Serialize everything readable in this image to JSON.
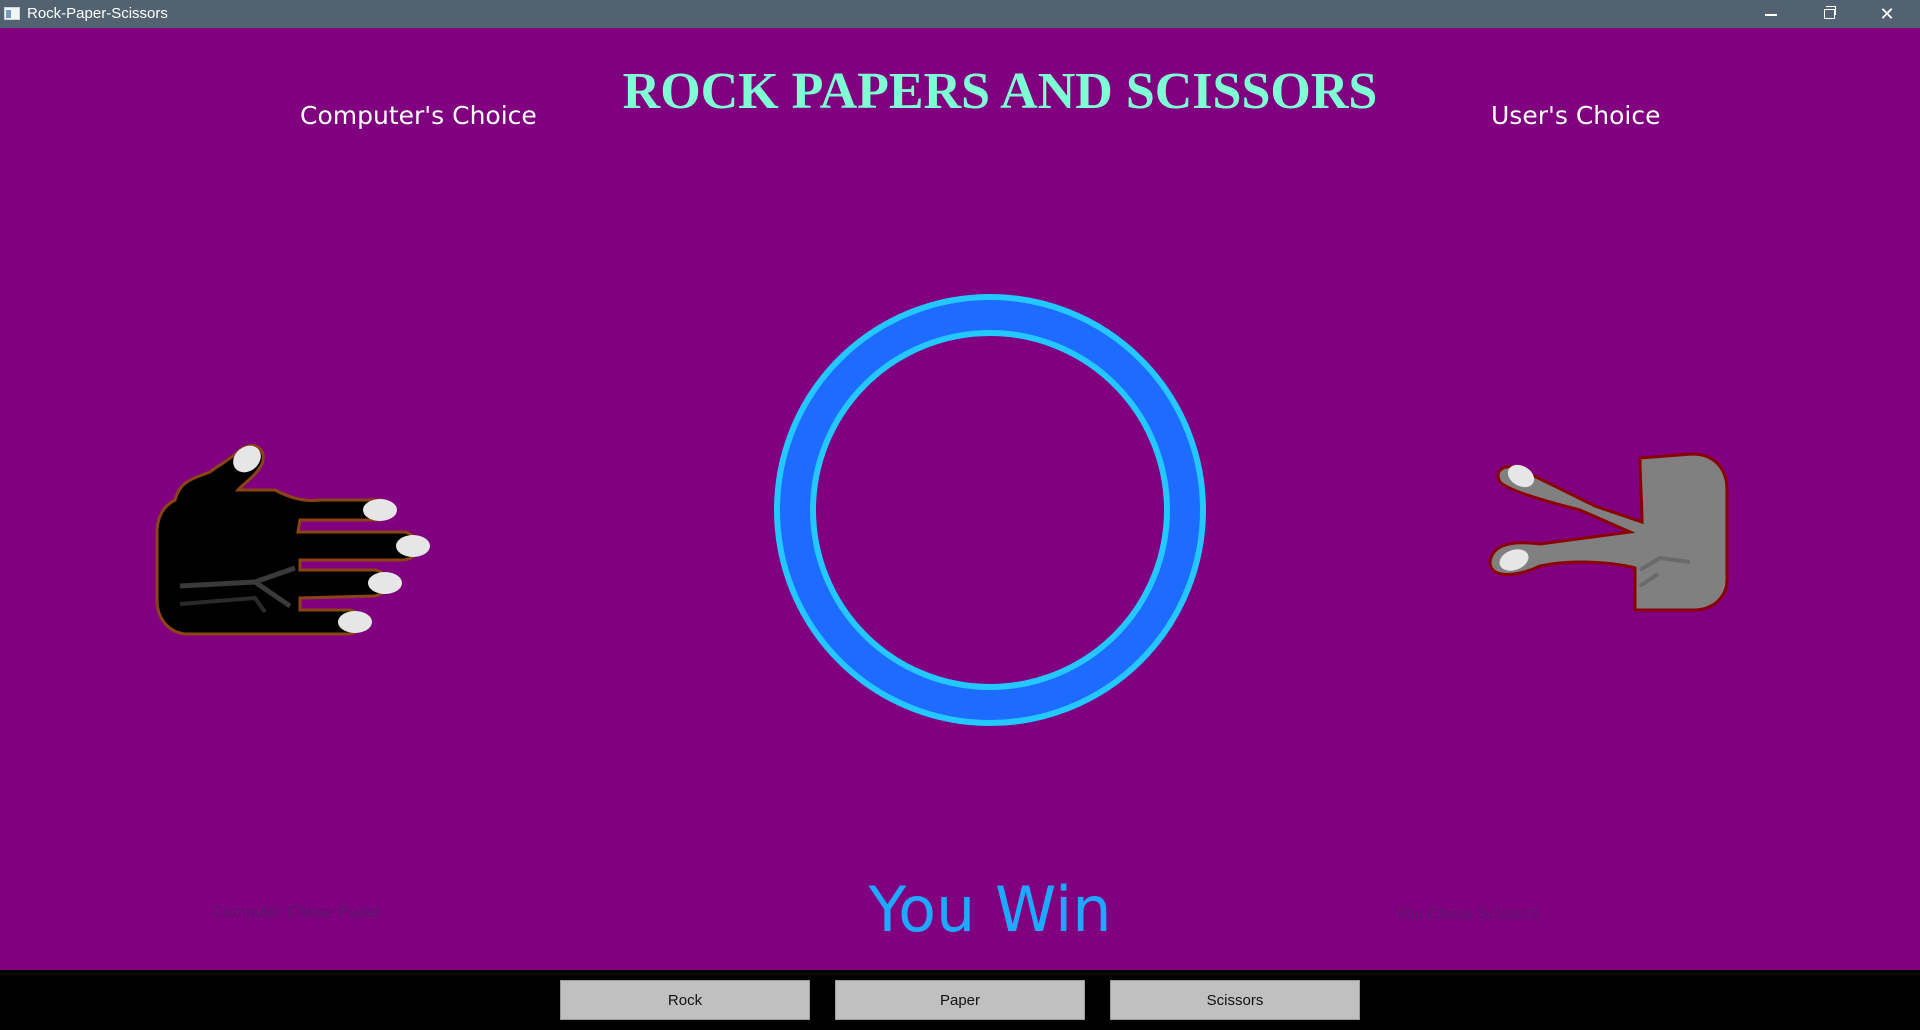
{
  "window": {
    "title": "Rock-Paper-Scissors",
    "minimize_icon": "minimize-icon",
    "maximize_icon": "restore-icon",
    "close_icon": "close-icon"
  },
  "game": {
    "title": "ROCK PAPERS AND SCISSORS",
    "computer_label": "Computer's Choice",
    "user_label": "User's Choice",
    "computer_caption": "Computer Chose Paper",
    "user_caption": "You Chose Scissors",
    "result": "You Win"
  },
  "buttons": {
    "rock": "Rock",
    "paper": "Paper",
    "scissors": "Scissors"
  },
  "colors": {
    "background": "#800080",
    "title": "#7fffd4",
    "result": "#1fa8ff",
    "ring_outer": "#1e6bff",
    "ring_edge": "#22c8ff",
    "computer_hand": "#000000",
    "user_hand": "#808080"
  }
}
